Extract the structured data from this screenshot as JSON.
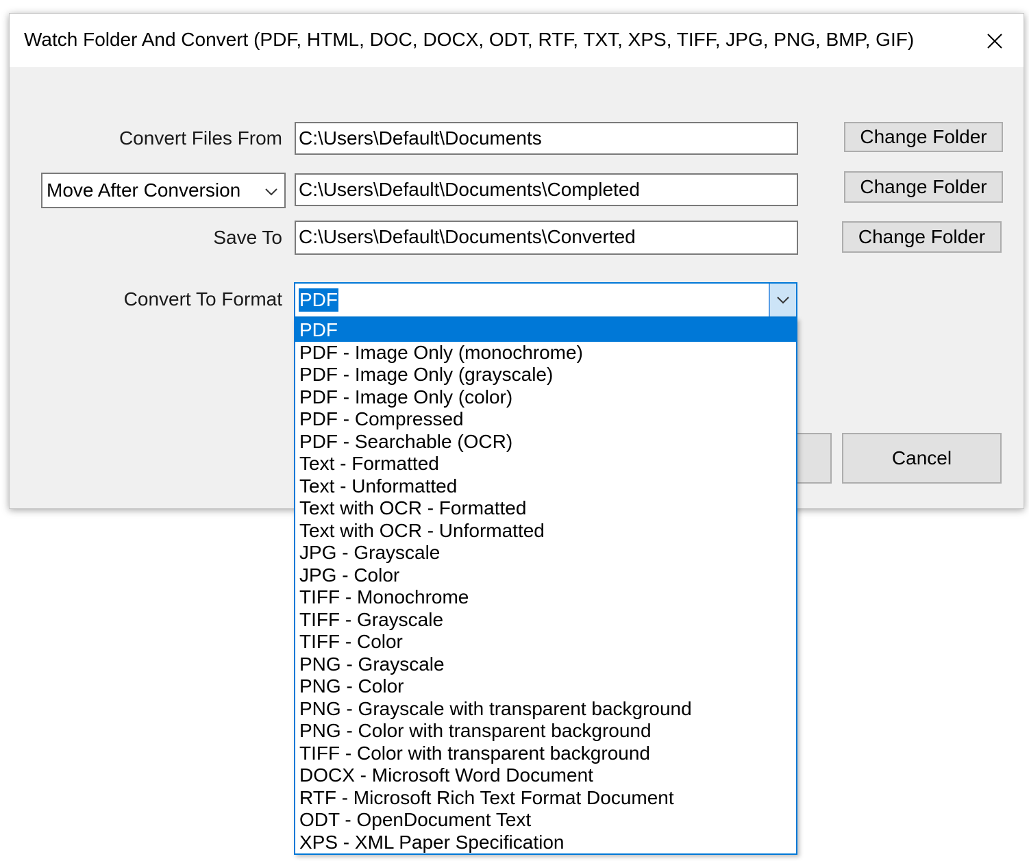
{
  "window": {
    "title": "Watch Folder And Convert (PDF, HTML, DOC, DOCX, ODT, RTF, TXT, XPS, TIFF, JPG, PNG, BMP, GIF)"
  },
  "icons": {
    "close": "close-icon",
    "chevron": "chevron-down-icon"
  },
  "colors": {
    "accent": "#0078d7",
    "window_bg": "#f0f0f0",
    "button_bg": "#e1e1e1"
  },
  "form": {
    "convert_from": {
      "label": "Convert Files From",
      "value": "C:\\Users\\Default\\Documents",
      "button": "Change Folder"
    },
    "after_action": {
      "selected": "Move After Conversion",
      "value": "C:\\Users\\Default\\Documents\\Completed",
      "button": "Change Folder"
    },
    "save_to": {
      "label": "Save To",
      "value": "C:\\Users\\Default\\Documents\\Converted",
      "button": "Change Folder"
    },
    "format": {
      "label": "Convert To Format",
      "selected": "PDF",
      "options": [
        "PDF",
        "PDF - Image Only (monochrome)",
        "PDF - Image Only (grayscale)",
        "PDF - Image Only (color)",
        "PDF - Compressed",
        "PDF - Searchable (OCR)",
        "Text - Formatted",
        "Text - Unformatted",
        "Text with OCR - Formatted",
        "Text with OCR - Unformatted",
        "JPG - Grayscale",
        "JPG - Color",
        "TIFF - Monochrome",
        "TIFF - Grayscale",
        "TIFF - Color",
        "PNG - Grayscale",
        "PNG - Color",
        "PNG - Grayscale with transparent background",
        "PNG - Color with transparent background",
        "TIFF - Color with transparent background",
        "DOCX - Microsoft Word Document",
        "RTF - Microsoft Rich Text Format Document",
        "ODT - OpenDocument Text",
        "XPS - XML Paper Specification"
      ]
    }
  },
  "actions": {
    "cancel": "Cancel"
  }
}
